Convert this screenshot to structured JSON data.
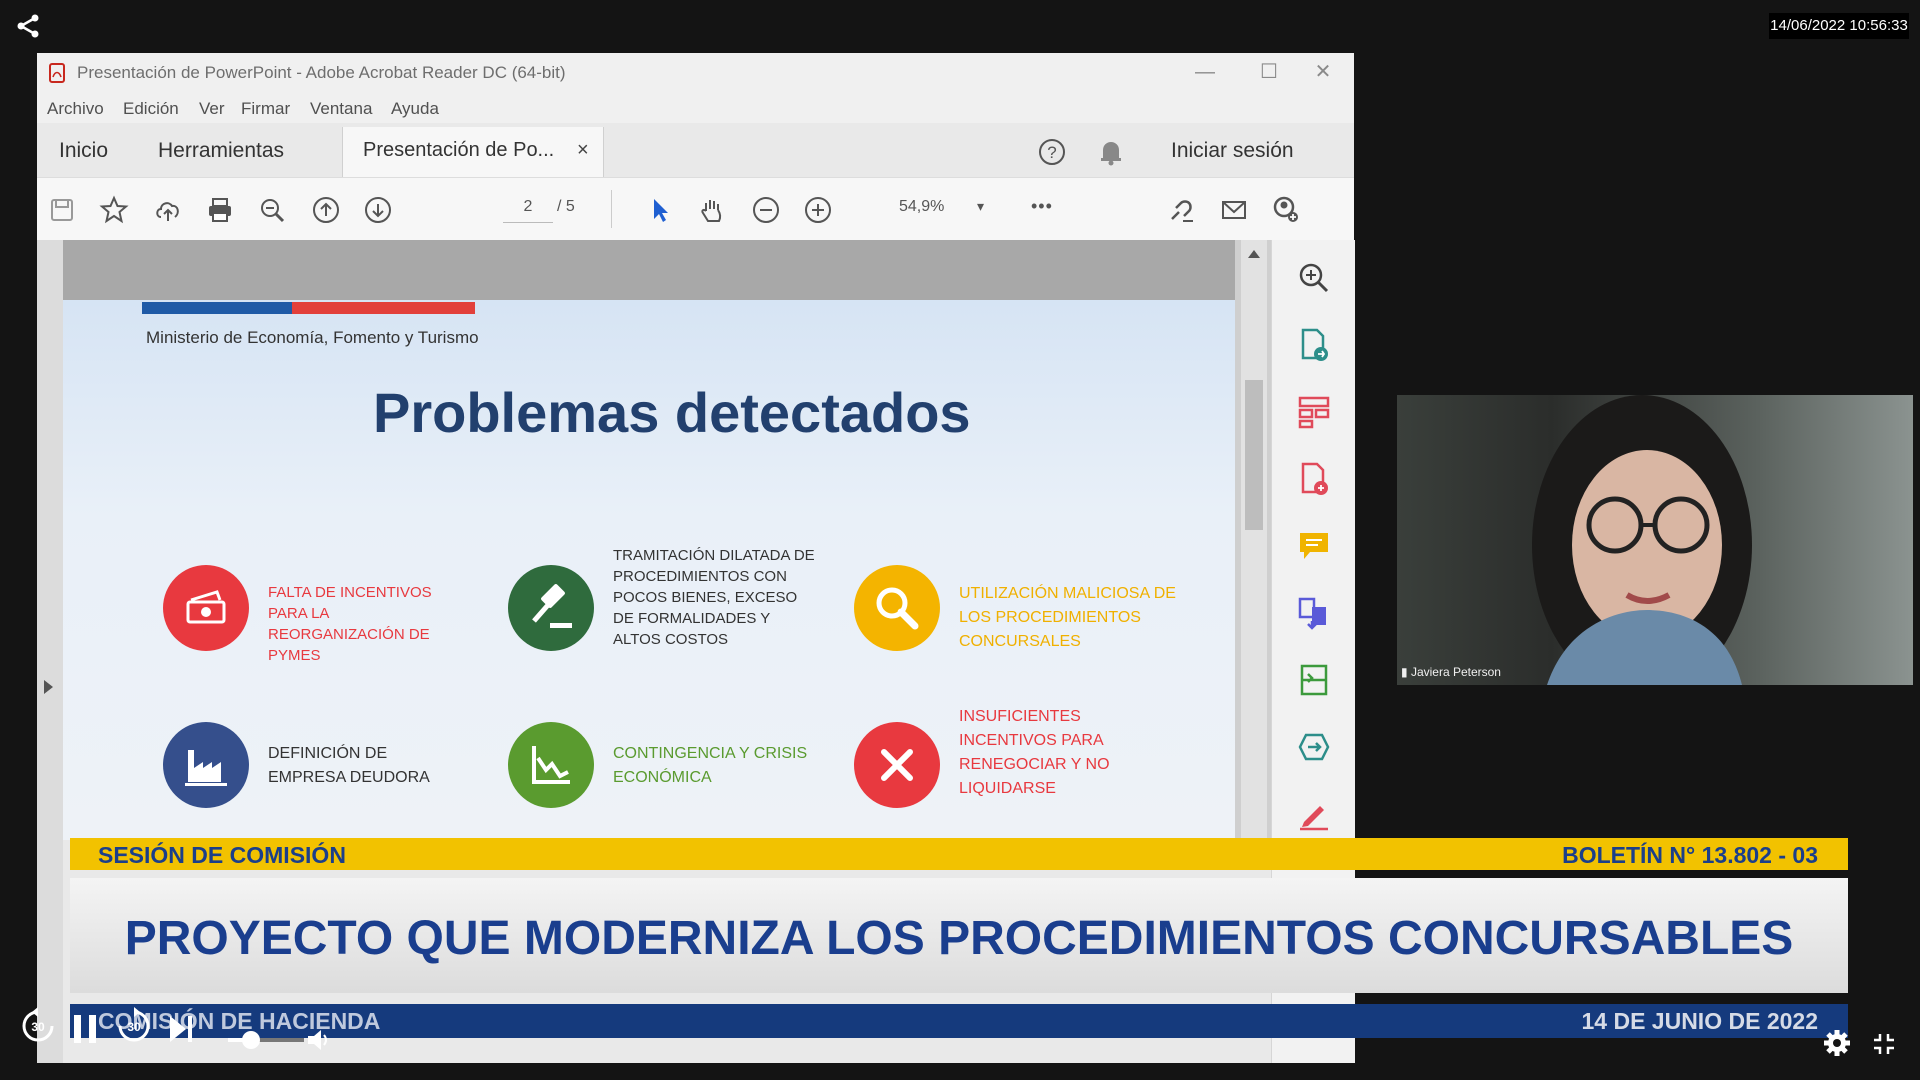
{
  "player": {
    "timestamp": "14/06/2022 10:56:33",
    "share_icon": "share-icon",
    "corner_text": "",
    "controls": [
      "rewind-30-icon",
      "pause-icon",
      "forward-30-icon",
      "next-icon",
      "volume-icon",
      "settings-icon",
      "exit-fullscreen-icon"
    ],
    "rewind_label": "30",
    "forward_label": "30",
    "volume": 0.3
  },
  "window": {
    "title": "Presentación de PowerPoint - Adobe Acrobat Reader DC (64-bit)",
    "menu": [
      "Archivo",
      "Edición",
      "Ver",
      "Firmar",
      "Ventana",
      "Ayuda"
    ],
    "tabs": {
      "home": "Inicio",
      "tools": "Herramientas",
      "doc": "Presentación de Po...",
      "close": "×"
    },
    "sign_in": "Iniciar sesión",
    "page_current": "2",
    "page_total": "/ 5",
    "zoom": "54,9%",
    "zoom_caret": "▾",
    "more": "•••"
  },
  "slide": {
    "ministry": "Ministerio de Economía, Fomento y Turismo",
    "title": "Problemas detectados",
    "items": [
      {
        "text": "FALTA DE INCENTIVOS PARA LA REORGANIZACIÓN DE PYMES",
        "color": "#e8393f",
        "icon": "money-icon"
      },
      {
        "text": "TRAMITACIÓN DILATADA DE PROCEDIMIENTOS CON POCOS BIENES, EXCESO DE FORMALIDADES Y ALTOS COSTOS",
        "color": "#2f6b3d",
        "icon": "gavel-icon"
      },
      {
        "text": "UTILIZACIÓN MALICIOSA DE LOS PROCEDIMIENTOS CONCURSALES",
        "color": "#f4b400",
        "icon": "magnifier-icon"
      },
      {
        "text": "DEFINICIÓN DE EMPRESA DEUDORA",
        "color": "#354f8c",
        "icon": "factory-icon"
      },
      {
        "text": "CONTINGENCIA Y CRISIS ECONÓMICA",
        "color": "#5a9b2f",
        "icon": "declining-chart-icon"
      },
      {
        "text": "INSUFICIENTES INCENTIVOS PARA RENEGOCIAR Y NO LIQUIDARSE",
        "color": "#e8393f",
        "icon": "x-mark-icon"
      }
    ]
  },
  "webcam": {
    "name": "Javiera Peterson"
  },
  "lower_third": {
    "session": "SESIÓN DE COMISIÓN",
    "bulletin": "BOLETÍN N° 13.802 - 03",
    "headline": "PROYECTO QUE MODERNIZA LOS PROCEDIMIENTOS CONCURSABLES",
    "committee": "COMISIÓN DE HACIENDA",
    "date": "14 DE JUNIO DE 2022"
  }
}
